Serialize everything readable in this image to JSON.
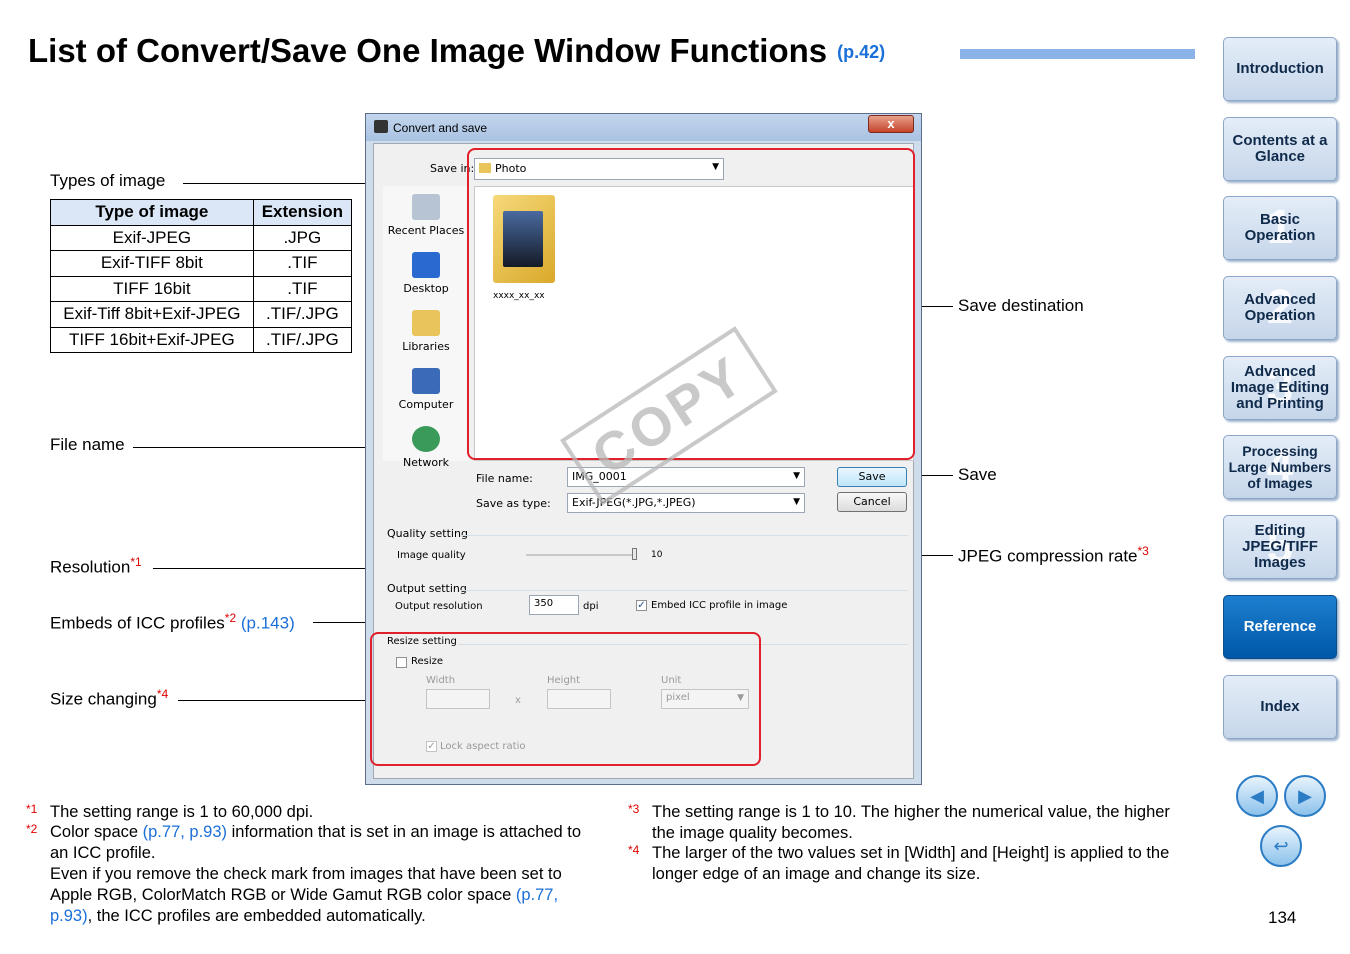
{
  "header": {
    "title": "List of Convert/Save One Image Window Functions",
    "ref": "(p.42)"
  },
  "callouts": {
    "types_of_image": "Types of image",
    "file_name": "File name",
    "resolution": "Resolution",
    "resolution_mark": "*1",
    "icc": "Embeds of ICC profiles",
    "icc_mark": "*2",
    "icc_ref": "(p.143)",
    "size_changing": "Size changing",
    "size_mark": "*4",
    "save_destination": "Save destination",
    "save": "Save",
    "jpeg_rate": "JPEG compression rate",
    "jpeg_mark": "*3"
  },
  "types_table": {
    "headers": [
      "Type of image",
      "Extension"
    ],
    "rows": [
      [
        "Exif-JPEG",
        ".JPG"
      ],
      [
        "Exif-TIFF 8bit",
        ".TIF"
      ],
      [
        "TIFF 16bit",
        ".TIF"
      ],
      [
        "Exif-Tiff 8bit+Exif-JPEG",
        ".TIF/.JPG"
      ],
      [
        "TIFF 16bit+Exif-JPEG",
        ".TIF/.JPG"
      ]
    ]
  },
  "dialog": {
    "title": "Convert and save",
    "close": "x",
    "save_in_label": "Save in:",
    "save_in_value": "Photo",
    "places": [
      "Recent Places",
      "Desktop",
      "Libraries",
      "Computer",
      "Network"
    ],
    "file_item": "xxxx_xx_xx",
    "file_name_label": "File name:",
    "file_name_value": "IMG_0001",
    "save_type_label": "Save as type:",
    "save_type_value": "Exif-JPEG(*.JPG,*.JPEG)",
    "save_button": "Save",
    "cancel_button": "Cancel",
    "quality_group": "Quality setting",
    "image_quality_label": "Image quality",
    "image_quality_value": "10",
    "output_group": "Output setting",
    "output_resolution_label": "Output resolution",
    "output_resolution_value": "350",
    "dpi": "dpi",
    "embed_icc": "Embed ICC profile in image",
    "resize_group": "Resize setting",
    "resize_label": "Resize",
    "width_label": "Width",
    "height_label": "Height",
    "unit_label": "Unit",
    "x_label": "x",
    "unit_value": "pixel",
    "lock_aspect": "Lock aspect ratio"
  },
  "stamp": "COPY",
  "sidebar": {
    "items": [
      {
        "label": "Introduction",
        "num": ""
      },
      {
        "label": "Contents at a Glance",
        "num": ""
      },
      {
        "label": "Basic Operation",
        "num": "1"
      },
      {
        "label": "Advanced Operation",
        "num": "2"
      },
      {
        "label": "Advanced Image Editing and Printing",
        "num": "3"
      },
      {
        "label": "Processing Large Numbers of Images",
        "num": "4"
      },
      {
        "label": "Editing JPEG/TIFF Images",
        "num": "5"
      },
      {
        "label": "Reference",
        "num": ""
      },
      {
        "label": "Index",
        "num": ""
      }
    ]
  },
  "footnotes": {
    "n1_mark": "*1",
    "n1": "The setting range is 1 to 60,000 dpi.",
    "n2_mark": "*2",
    "n2_a": "Color space",
    "n2_ref1": "(p.77, p.93)",
    "n2_b": "information that is set in an image is attached to an ICC profile.",
    "n2_c": "Even if you remove the check mark from images that have been set to Apple RGB, ColorMatch RGB or Wide Gamut RGB color space",
    "n2_ref2": "(p.77, p.93)",
    "n2_d": ", the ICC profiles are embedded automatically.",
    "n3_mark": "*3",
    "n3": "The setting range is 1 to 10. The higher the numerical value, the higher the image quality becomes.",
    "n4_mark": "*4",
    "n4": "The larger of the two values set in [Width] and [Height] is applied to the longer edge of an image and change its size."
  },
  "page_number": "134",
  "colors": {
    "link": "#1a6fd8",
    "highlight": "#e0202a",
    "active_tab": "#0057a8"
  }
}
